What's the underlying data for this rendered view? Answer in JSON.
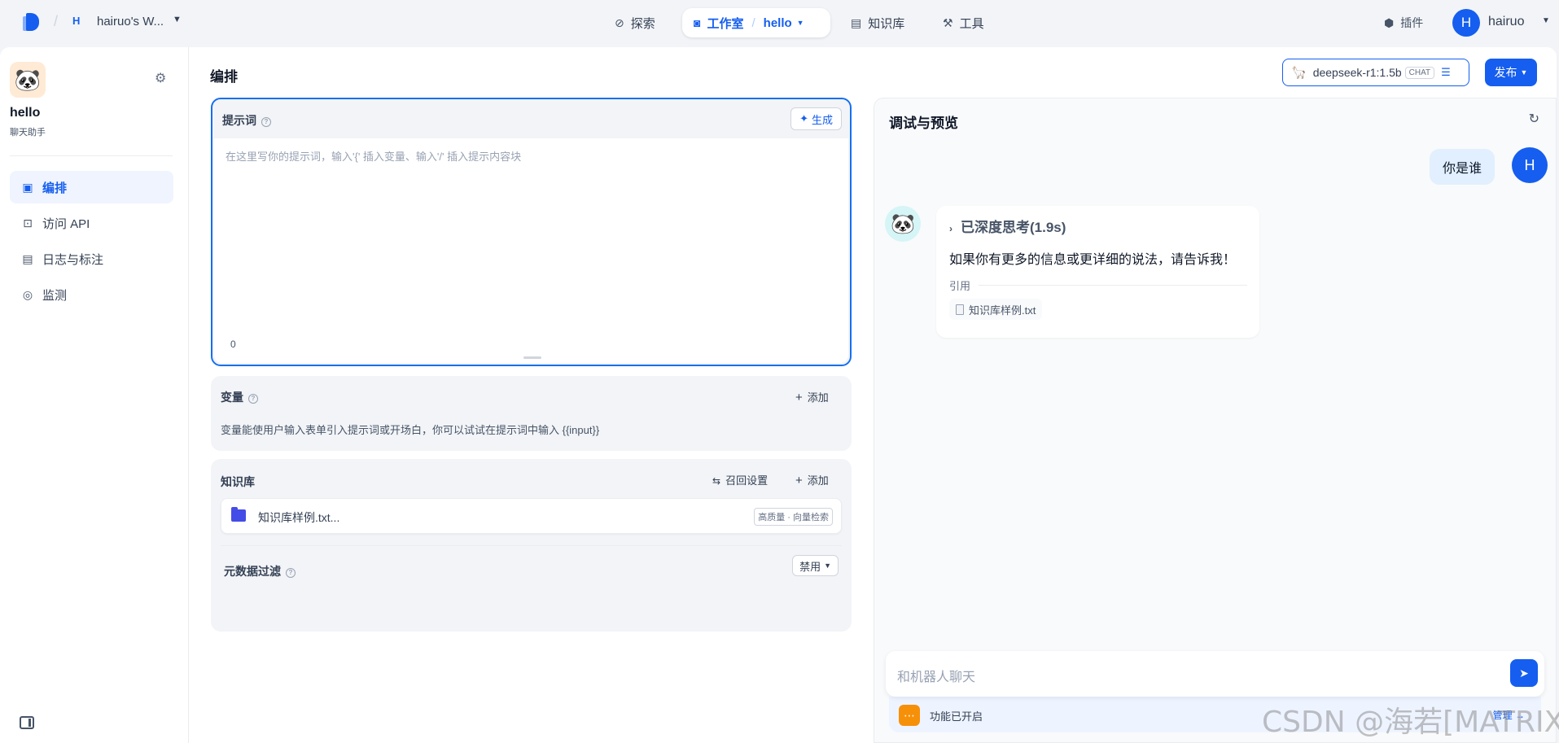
{
  "topbar": {
    "workspace_badge": "H",
    "workspace_name": "hairuo's W...",
    "nav": {
      "explore": "探索",
      "studio": "工作室",
      "studio_app": "hello",
      "knowledge": "知识库",
      "tools": "工具"
    },
    "plugins": "插件",
    "user_initial": "H",
    "user_name": "hairuo"
  },
  "sidebar": {
    "app_name": "hello",
    "app_type": "聊天助手",
    "items": [
      {
        "label": "编排",
        "icon": "layout-icon",
        "active": true
      },
      {
        "label": "访问 API",
        "icon": "terminal-icon",
        "active": false
      },
      {
        "label": "日志与标注",
        "icon": "file-list-icon",
        "active": false
      },
      {
        "label": "监测",
        "icon": "gauge-icon",
        "active": false
      }
    ]
  },
  "editor": {
    "title": "编排",
    "prompt": {
      "label": "提示词",
      "generate": "生成",
      "placeholder": "在这里写你的提示词，输入'{' 插入变量、输入'/' 插入提示内容块",
      "count": "0"
    },
    "variables": {
      "label": "变量",
      "add": "添加",
      "description": "变量能使用户输入表单引入提示词或开场白，你可以试试在提示词中输入 {{input}}"
    },
    "knowledge": {
      "label": "知识库",
      "recall_settings": "召回设置",
      "add": "添加",
      "item_name": "知识库样例.txt...",
      "item_tag": "高质量 · 向量检索",
      "metadata_filter": "元数据过滤",
      "metadata_value": "禁用"
    }
  },
  "model": {
    "name": "deepseek-r1:1.5b",
    "mode": "CHAT",
    "publish": "发布"
  },
  "preview": {
    "title": "调试与预览",
    "user_message": "你是谁",
    "user_initial": "H",
    "thinking": "已深度思考(1.9s)",
    "bot_message": "如果你有更多的信息或更详细的说法，请告诉我！",
    "citation_label": "引用",
    "citation_file": "知识库样例.txt",
    "input_placeholder": "和机器人聊天",
    "feature_text": "功能已开启",
    "feature_manage": "管理"
  },
  "watermark": "CSDN @海若[MATRIX]",
  "colors": {
    "accent": "#155eef",
    "accent_light": "#eff4ff",
    "background": "#f2f4f7",
    "feature_icon": "#f79009"
  }
}
